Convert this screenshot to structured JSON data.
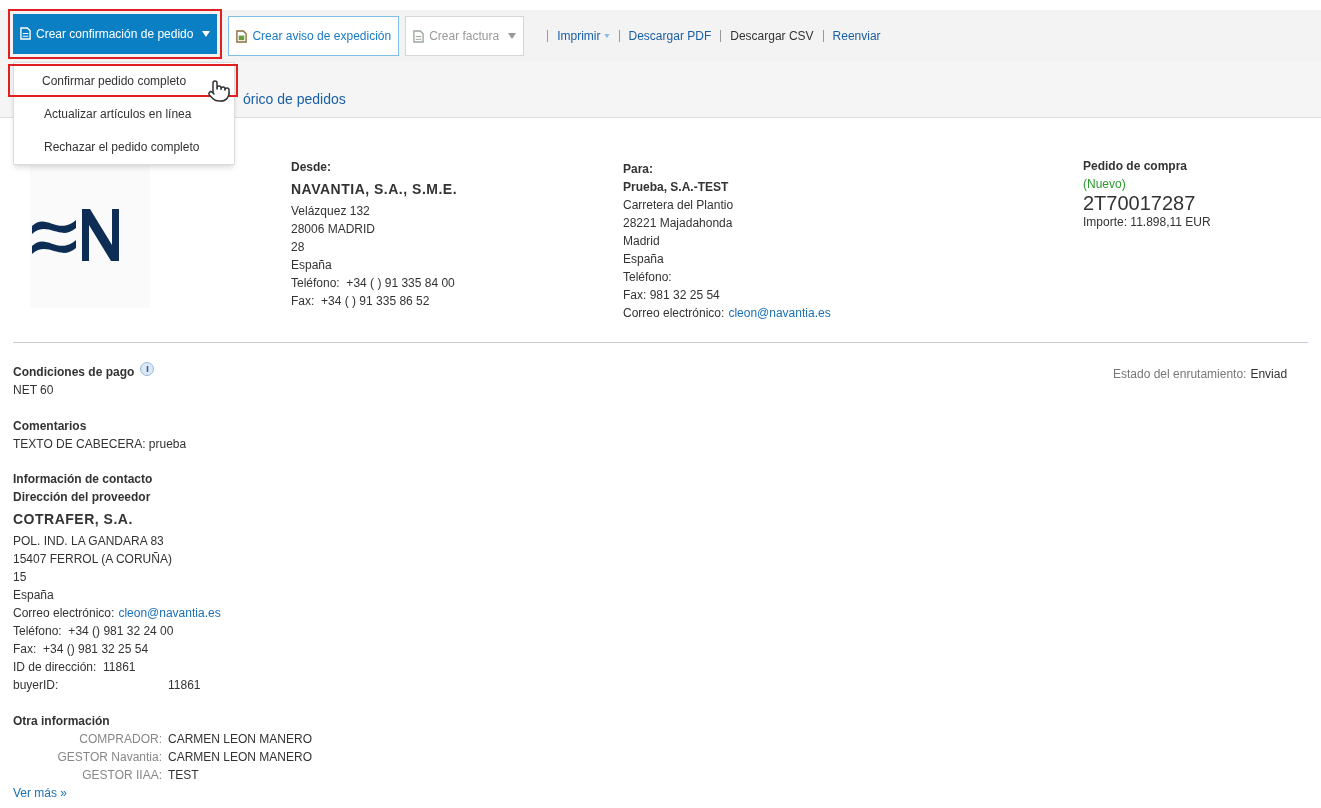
{
  "toolbar": {
    "buttons": [
      {
        "kind": "primary",
        "label": "Crear confirmación de pedido",
        "dropdown": true,
        "highlighted": true
      },
      {
        "kind": "outline",
        "label": "Crear aviso de expedición",
        "dropdown": false,
        "highlighted": false
      },
      {
        "kind": "disabled",
        "label": "Crear factura",
        "dropdown": true,
        "highlighted": false
      }
    ],
    "links": [
      {
        "label": "Imprimir",
        "dropdown": true,
        "kind": "link"
      },
      {
        "label": "Descargar PDF",
        "dropdown": false,
        "kind": "link"
      },
      {
        "label": "Descargar CSV",
        "dropdown": false,
        "kind": "text"
      },
      {
        "label": "Reenviar",
        "dropdown": false,
        "kind": "link"
      }
    ]
  },
  "menu": {
    "items": [
      {
        "label": "Confirmar pedido completo",
        "highlighted": true
      },
      {
        "label": "Actualizar artículos en línea",
        "highlighted": false
      },
      {
        "label": "Rechazar el pedido completo",
        "highlighted": false
      }
    ]
  },
  "subnav": {
    "label": "órico de pedidos"
  },
  "from": {
    "label": "Desde:",
    "name": "NAVANTIA, S.A., S.M.E.",
    "lines": [
      {
        "text": "Velázquez 132"
      },
      {
        "text": "28006 MADRID"
      },
      {
        "text": "28"
      },
      {
        "text": "España"
      },
      {
        "text": "Teléfono:  +34 ( ) 91 335 84 00"
      },
      {
        "text": "Fax:  +34 ( ) 91 335 86 52"
      }
    ]
  },
  "to": {
    "label": "Para:",
    "name": "Prueba, S.A.-TEST",
    "lines": [
      {
        "text": "Carretera del Plantio"
      },
      {
        "text": "28221 Majadahonda"
      },
      {
        "text": "Madrid"
      },
      {
        "text": "España"
      },
      {
        "text": "Teléfono:"
      },
      {
        "text": "Fax: 981 32 25 54"
      },
      {
        "text": "Correo electrónico:",
        "link": "cleon@navantia.es"
      }
    ]
  },
  "order": {
    "title": "Pedido de compra",
    "status": "(Nuevo)",
    "number": "2T70017287",
    "amount": "Importe: 11.898,11 EUR"
  },
  "routing": {
    "label": "Estado del enrutamiento:",
    "value": "Enviad"
  },
  "payment": {
    "title": "Condiciones de pago",
    "value": "NET 60"
  },
  "comments": {
    "title": "Comentarios",
    "value": "TEXTO DE CABECERA: prueba"
  },
  "contact": {
    "title": "Información de contacto",
    "subtitle": "Dirección del proveedor",
    "name": "COTRAFER, S.A.",
    "lines": [
      {
        "text": "POL. IND. LA GANDARA 83"
      },
      {
        "text": "15407 FERROL (A CORUÑA)"
      },
      {
        "text": "15"
      },
      {
        "text": "España"
      },
      {
        "text": "Correo electrónico:",
        "link": "cleon@navantia.es"
      },
      {
        "text": "Teléfono:  +34 () 981 32 24 00"
      },
      {
        "text": "Fax:  +34 () 981 32 25 54"
      },
      {
        "text": "ID de dirección:  11861"
      }
    ],
    "buyer": {
      "label": "buyerID:",
      "value": "11861"
    }
  },
  "other": {
    "title": "Otra información",
    "rows": [
      {
        "label": "COMPRADOR:",
        "value": "CARMEN LEON MANERO"
      },
      {
        "label": "GESTOR Navantia:",
        "value": "CARMEN LEON MANERO"
      },
      {
        "label": "GESTOR IIAA:",
        "value": "TEST"
      }
    ],
    "more": "Ver más »"
  }
}
